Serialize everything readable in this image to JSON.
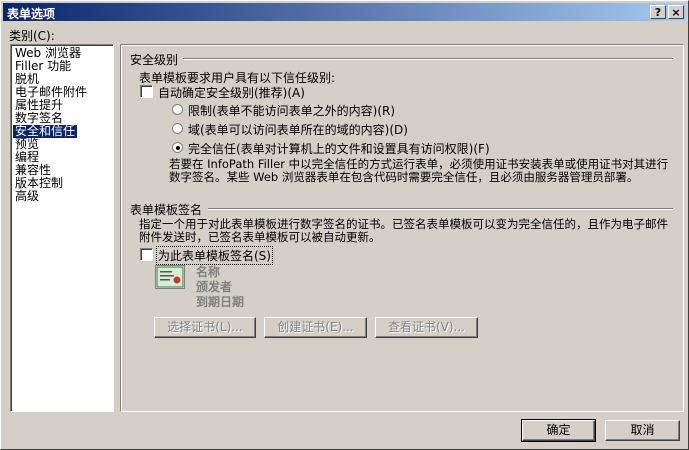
{
  "window": {
    "title": "表单选项",
    "help_btn": "?",
    "close_btn": "×"
  },
  "category_label": "类别(C):",
  "categories": [
    "Web 浏览器",
    "Filler 功能",
    "脱机",
    "电子邮件附件",
    "属性提升",
    "数字签名",
    "安全和信任",
    "预览",
    "编程",
    "兼容性",
    "版本控制",
    "高级"
  ],
  "selected_category": "安全和信任",
  "security": {
    "heading": "安全级别",
    "intro": "表单模板要求用户具有以下信任级别:",
    "auto_label": "自动确定安全级别(推荐)(A)",
    "auto_checked": false,
    "options": [
      {
        "label": "限制(表单不能访问表单之外的内容)(R)",
        "selected": false
      },
      {
        "label": "域(表单可以访问表单所在的域的内容)(D)",
        "selected": false
      },
      {
        "label": "完全信任(表单对计算机上的文件和设置具有访问权限)(F)",
        "selected": true
      }
    ],
    "note": "若要在 InfoPath Filler 中以完全信任的方式运行表单，必须使用证书安装表单或使用证书对其进行数字签名。某些 Web 浏览器表单在包含代码时需要完全信任，且必须由服务器管理员部署。"
  },
  "signature": {
    "heading": "表单模板签名",
    "description": "指定一个用于对此表单模板进行数字签名的证书。已签名表单模板可以变为完全信任的，且作为电子邮件附件发送时，已签名表单模板可以被自动更新。",
    "sign_label": "为此表单模板签名(S)",
    "sign_checked": false,
    "cert_name": "名称",
    "cert_issuer": "颁发者",
    "cert_expiry": "到期日期",
    "buttons": {
      "select": "选择证书(L)...",
      "create": "创建证书(E)...",
      "view": "查看证书(V)..."
    }
  },
  "footer": {
    "ok": "确定",
    "cancel": "取消"
  }
}
